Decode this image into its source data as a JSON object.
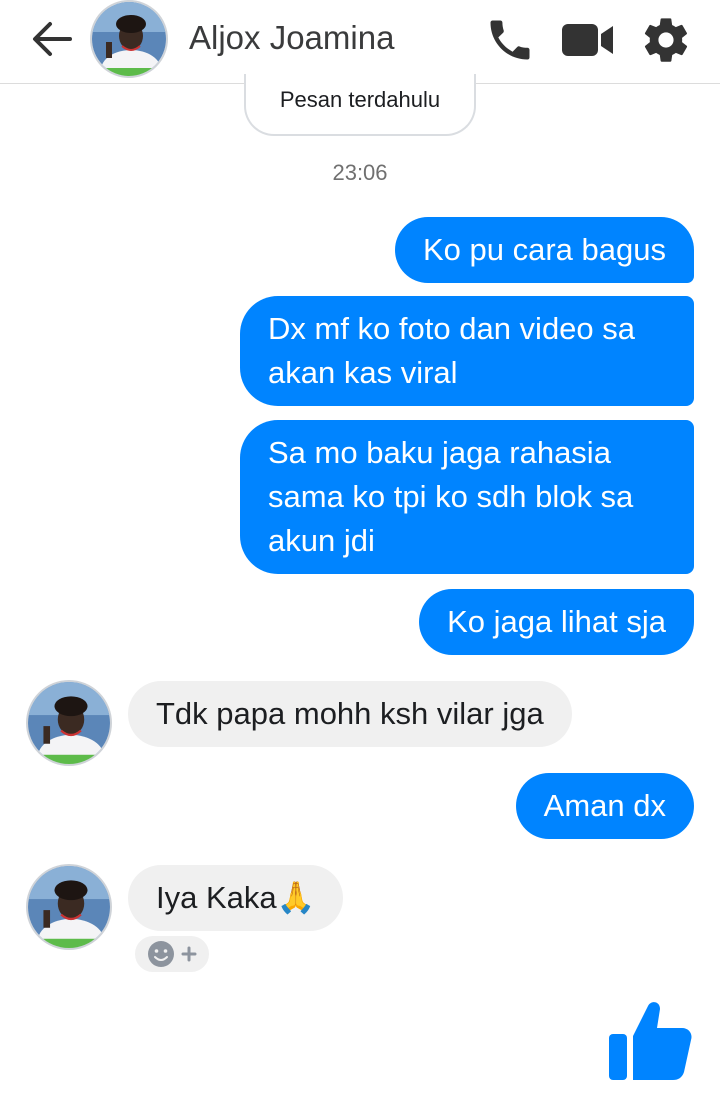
{
  "header": {
    "contact_name": "Aljox Joamina"
  },
  "conversation": {
    "older_messages_label": "Pesan terdahulu",
    "timestamp": "23:06",
    "messages": [
      {
        "direction": "outgoing",
        "lines": [
          "Ko pu cara bagus"
        ]
      },
      {
        "direction": "outgoing",
        "lines": [
          "Dx mf ko foto dan video sa",
          "akan kas viral"
        ]
      },
      {
        "direction": "outgoing",
        "lines": [
          "Sa mo baku jaga rahasia",
          "sama ko tpi ko sdh blok sa",
          "akun jdi"
        ]
      },
      {
        "direction": "outgoing",
        "lines": [
          "Ko jaga lihat sja"
        ]
      },
      {
        "direction": "incoming",
        "lines": [
          "Tdk papa mohh ksh vilar jga"
        ]
      },
      {
        "direction": "outgoing",
        "lines": [
          "Aman dx"
        ]
      },
      {
        "direction": "incoming",
        "lines": [
          "Iya Kaka🙏"
        ]
      }
    ]
  },
  "colors": {
    "outgoing_bubble": "#0084ff",
    "incoming_bubble": "#f0f0f0",
    "accent": "#0084ff"
  },
  "icons": [
    "back-arrow-icon",
    "phone-icon",
    "video-camera-icon",
    "gear-icon",
    "emoji-reaction-icon",
    "thumbs-up-icon"
  ]
}
